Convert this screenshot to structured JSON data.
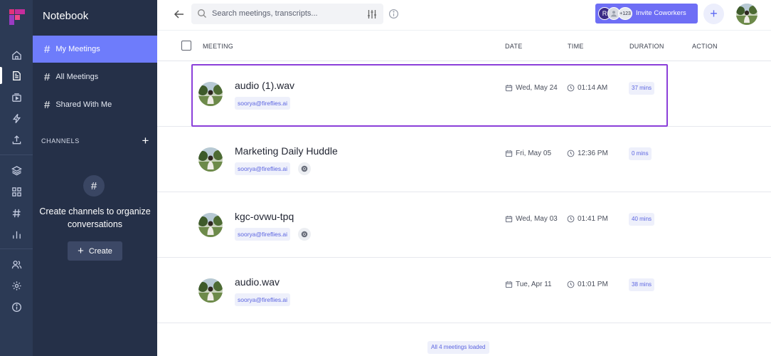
{
  "sidebar": {
    "title": "Notebook",
    "items": [
      {
        "label": "My Meetings"
      },
      {
        "label": "All Meetings"
      },
      {
        "label": "Shared With Me"
      }
    ],
    "channels": {
      "heading": "CHANNELS",
      "empty_text": "Create channels to organize conversations",
      "create_label": "Create"
    }
  },
  "rail": {
    "icons": [
      "home-icon",
      "notebook-icon",
      "video-icon",
      "bolt-icon",
      "upload-icon",
      "layers-icon",
      "grid-icon",
      "hash-icon",
      "analytics-icon",
      "team-icon",
      "settings-icon",
      "info-icon"
    ]
  },
  "header": {
    "search_placeholder": "Search meetings, transcripts...",
    "invite": {
      "initial": "R",
      "count": "+123",
      "label": "Invite Coworkers"
    }
  },
  "table": {
    "columns": {
      "meeting": "MEETING",
      "date": "DATE",
      "time": "TIME",
      "duration": "DURATION",
      "action": "ACTION"
    },
    "rows": [
      {
        "title": "audio (1).wav",
        "email": "soorya@fireflies.ai",
        "date": "Wed, May 24",
        "time": "01:14 AM",
        "duration": "37 mins",
        "chrome": false
      },
      {
        "title": "Marketing Daily Huddle",
        "email": "soorya@fireflies.ai",
        "date": "Fri, May 05",
        "time": "12:36 PM",
        "duration": "0 mins",
        "chrome": true
      },
      {
        "title": "kgc-ovwu-tpq",
        "email": "soorya@fireflies.ai",
        "date": "Wed, May 03",
        "time": "01:41 PM",
        "duration": "40 mins",
        "chrome": true
      },
      {
        "title": "audio.wav",
        "email": "soorya@fireflies.ai",
        "date": "Tue, Apr 11",
        "time": "01:01 PM",
        "duration": "38 mins",
        "chrome": false
      }
    ],
    "footer": "All 4 meetings loaded"
  },
  "colors": {
    "accent": "#6e7cfb",
    "sidebar": "#253048",
    "rail": "#2c3a55",
    "selection": "#8b3fd9"
  }
}
